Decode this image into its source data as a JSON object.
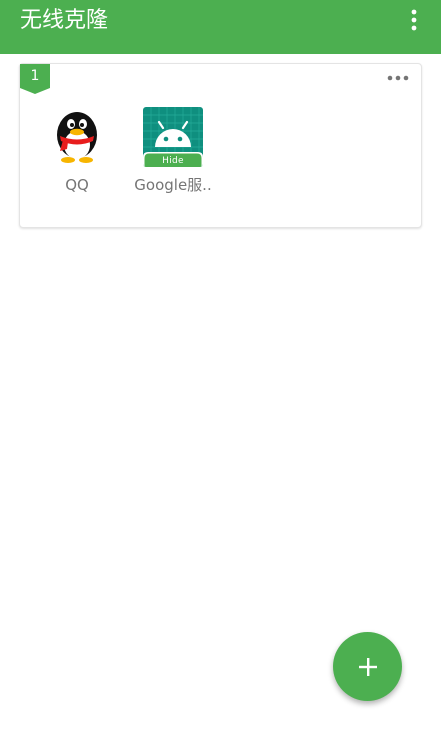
{
  "app_bar": {
    "title": "无线克隆",
    "overflow_icon": "more-vertical-icon"
  },
  "group": {
    "number": "1",
    "more_icon": "more-horizontal-icon",
    "apps": [
      {
        "label": "QQ",
        "icon": "qq-penguin-icon",
        "hidden": false
      },
      {
        "label": "Google服..",
        "icon": "android-robot-icon",
        "hidden": true,
        "tag": "Hide"
      }
    ]
  },
  "fab": {
    "icon": "plus-icon"
  },
  "colors": {
    "primary": "#4caf50",
    "icon_bg": "#0f8f7f",
    "label": "#757575"
  }
}
